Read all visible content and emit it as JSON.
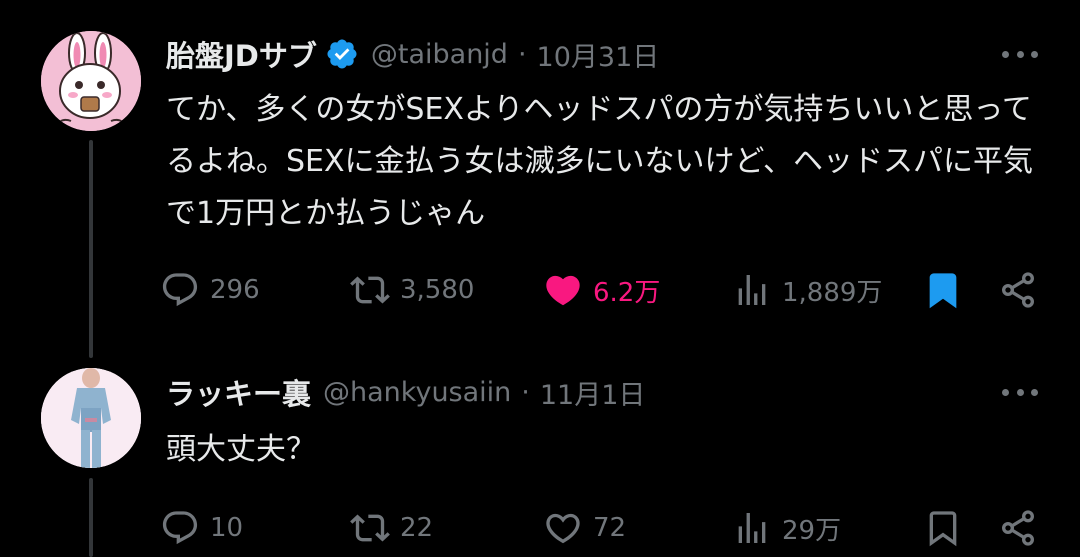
{
  "colors": {
    "background": "#000000",
    "text": "#e7e9ea",
    "secondary_text": "#71767b",
    "like_active": "#f91880",
    "bookmark_active": "#1d9bf0",
    "verified_badge": "#1d9bf0",
    "thread_line": "#333639"
  },
  "tweets": [
    {
      "display_name": "胎盤JDサブ",
      "verified": true,
      "handle": "@taibanjd",
      "separator": "·",
      "date": "10月31日",
      "text": "てか、多くの女がSEXよりヘッドスパの方が気持ちいいと思ってるよね。SEXに金払う女は滅多にいないけど、ヘッドスパに平気で1万円とか払うじゃん",
      "avatar_icon": "pink-rabbit-avatar",
      "actions": {
        "replies": "296",
        "retweets": "3,580",
        "likes": "6.2万",
        "views": "1,889万",
        "liked": true,
        "bookmarked": true
      }
    },
    {
      "display_name": "ラッキー裏",
      "verified": false,
      "handle": "@hankyusaiin",
      "separator": "·",
      "date": "11月1日",
      "text": "頭大丈夫？",
      "avatar_icon": "person-photo-avatar",
      "actions": {
        "replies": "10",
        "retweets": "22",
        "likes": "72",
        "views": "29万",
        "liked": false,
        "bookmarked": false
      }
    }
  ]
}
